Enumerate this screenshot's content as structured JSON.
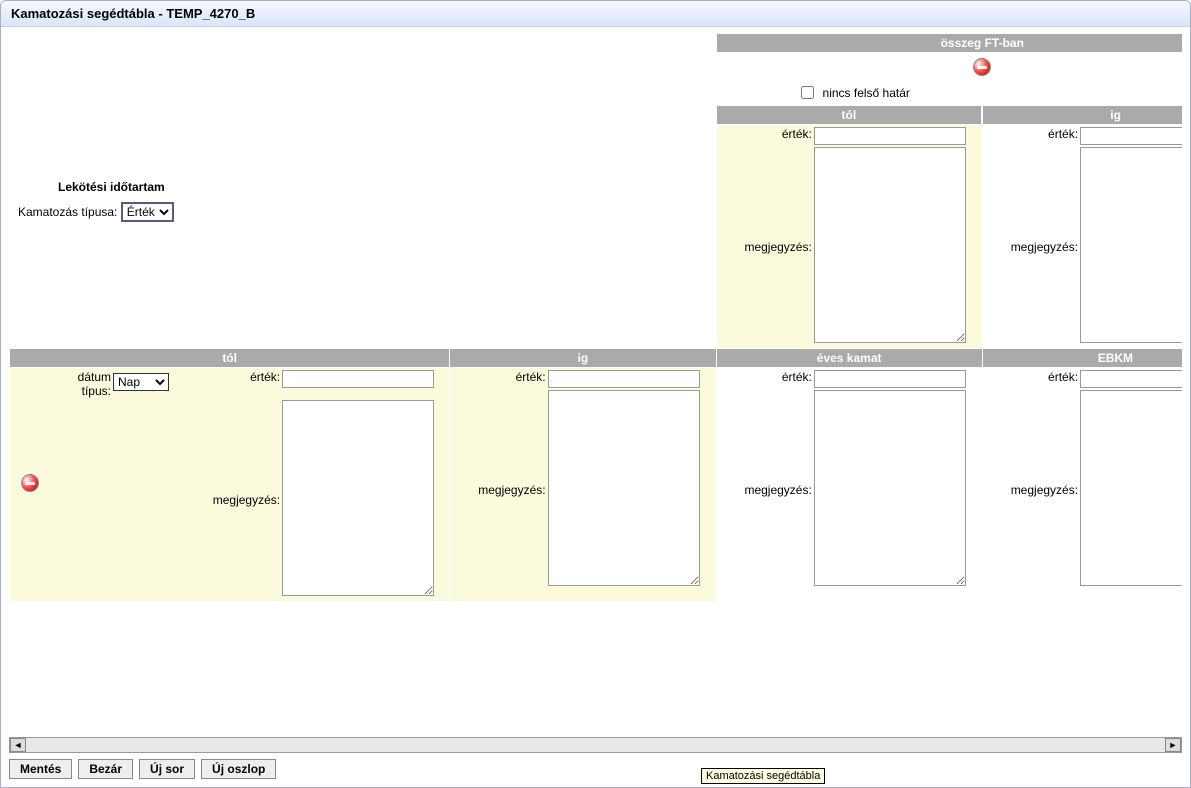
{
  "window": {
    "title": "Kamatozási segédtábla - TEMP_4270_B"
  },
  "labels": {
    "osszeg_ft": "összeg FT-ban",
    "nincs_felso": "nincs felső határ",
    "tol": "tól",
    "ig": "ig",
    "ertek": "érték:",
    "megjegyzes": "megjegyzés:",
    "eves_kamat": "éves kamat",
    "ebkm": "EBKM",
    "lekotesi": "Lekötési időtartam",
    "kamatozas_tipusa": "Kamatozás típusa:",
    "datum_tipus_line1": "dátum",
    "datum_tipus_line2": "típus:"
  },
  "selects": {
    "kamatozas_tipusa": {
      "value": "Érték",
      "options": [
        "Érték"
      ]
    },
    "datum_tipus": {
      "value": "Nap",
      "options": [
        "Nap"
      ]
    }
  },
  "checkboxes": {
    "nincs_felso": false
  },
  "upper": {
    "tol": {
      "ertek": "",
      "megjegyzes": ""
    },
    "ig": {
      "ertek": "",
      "megjegyzes": ""
    }
  },
  "lower": {
    "tol": {
      "ertek": "",
      "megjegyzes": ""
    },
    "ig": {
      "ertek": "",
      "megjegyzes": ""
    },
    "eves_kamat": {
      "ertek": "",
      "megjegyzes": ""
    },
    "ebkm": {
      "ertek": "",
      "megjegyzes": ""
    }
  },
  "buttons": {
    "mentes": "Mentés",
    "bezar": "Bezár",
    "uj_sor": "Új sor",
    "uj_oszlop": "Új oszlop"
  },
  "tooltip": "Kamatozási segédtábla"
}
